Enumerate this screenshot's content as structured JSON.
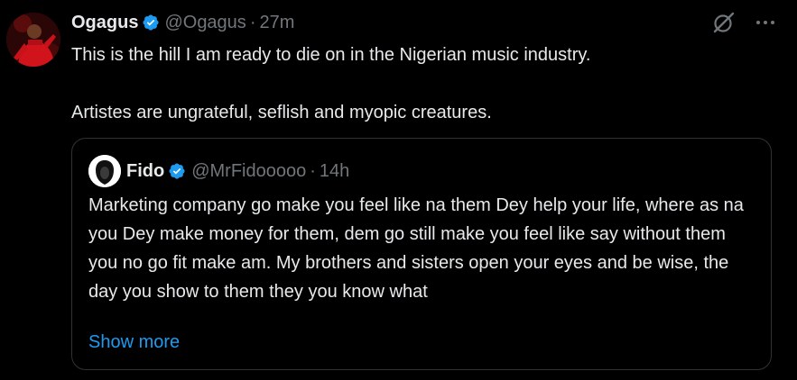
{
  "tweet": {
    "author_name": "Ogagus",
    "author_handle": "@Ogagus",
    "separator": "·",
    "time": "27m",
    "text": "This is the hill I am ready to die on in the Nigerian music industry.\n\nArtistes are ungrateful, seflish and myopic creatures."
  },
  "quote": {
    "author_name": "Fido",
    "author_handle": "@MrFidooooo",
    "separator": "·",
    "time": "14h",
    "text": "Marketing company go make you feel like na them Dey help your life, where as na you Dey make money for them, dem go still make you feel like say without them you no go fit make am. My brothers and sisters open your eyes and be wise, the day you show to them they you know what",
    "show_more": "Show more"
  },
  "icons": {
    "verified": "verified-badge-icon",
    "grok": "grok-icon",
    "more": "more-options-icon"
  },
  "colors": {
    "background": "#000000",
    "text": "#e7e9ea",
    "muted": "#71767b",
    "accent": "#1d9bf0",
    "border": "#2f3336"
  }
}
